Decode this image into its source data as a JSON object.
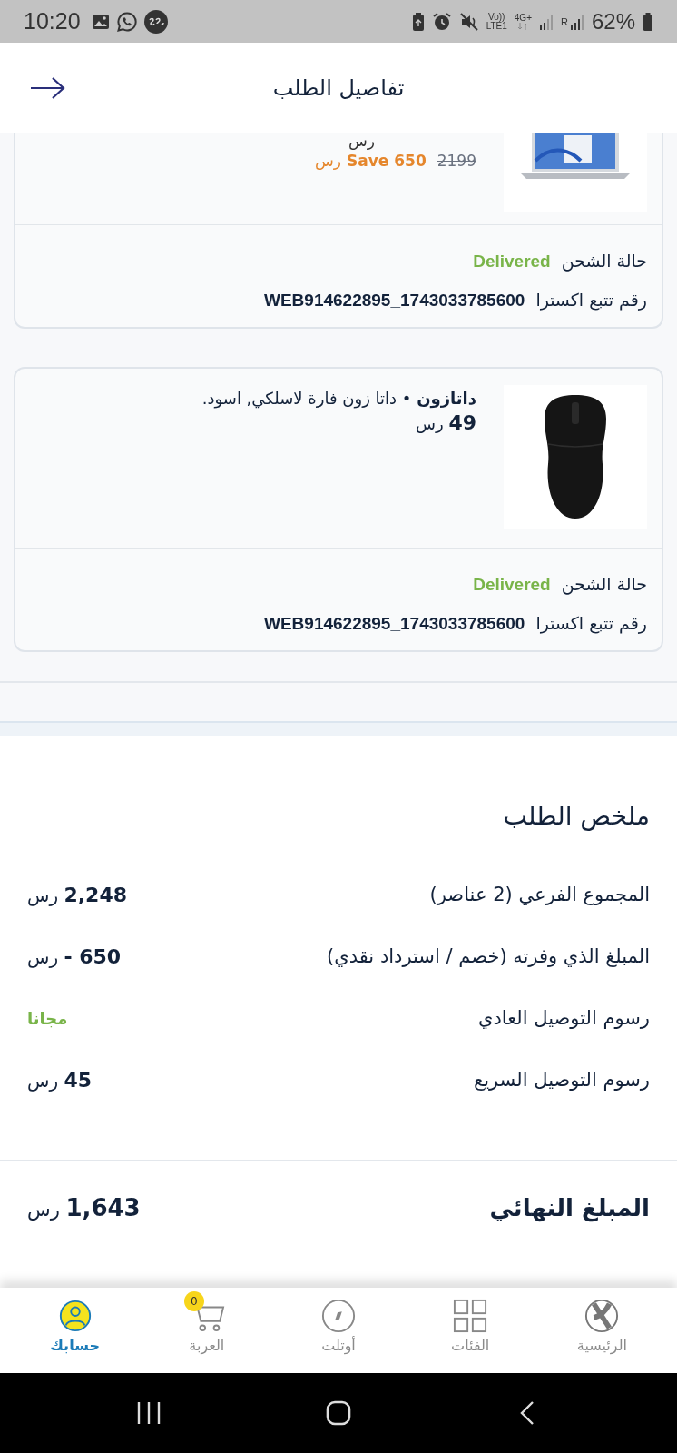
{
  "status_bar": {
    "time": "10:20",
    "volte_top": "Vo))",
    "volte_bottom": "LTE1",
    "network": "4G+",
    "roaming": "R",
    "battery": "62%"
  },
  "header": {
    "title": "تفاصيل الطلب"
  },
  "items": [
    {
      "kind": "laptop",
      "cut_currency": "رس",
      "original_price": "2199",
      "savings": "Save 650",
      "savings_currency": "رس",
      "shipping_label": "حالة الشحن",
      "shipping_status": "Delivered",
      "tracking_label": "رقم تتبع اكسترا",
      "tracking_number": "WEB914622895_1743033785600"
    },
    {
      "kind": "mouse",
      "brand": "داتازون",
      "separator": "•",
      "name": "داتا زون فارة لاسلكي, اسود.",
      "price": "49",
      "currency": "رس",
      "shipping_label": "حالة الشحن",
      "shipping_status": "Delivered",
      "tracking_label": "رقم تتبع اكسترا",
      "tracking_number": "WEB914622895_1743033785600"
    }
  ],
  "summary": {
    "title": "ملخص الطلب",
    "rows": [
      {
        "label": "المجموع الفرعي (2 عناصر)",
        "kind": "amount",
        "value": "2,248",
        "currency": "رس"
      },
      {
        "label": "المبلغ الذي وفرته (خصم / استرداد نقدي)",
        "kind": "amount",
        "value": "- 650",
        "currency": "رس"
      },
      {
        "label": "رسوم التوصيل العادي",
        "kind": "free",
        "value": "مجانا"
      },
      {
        "label": "رسوم التوصيل السريع",
        "kind": "amount",
        "value": "45",
        "currency": "رس"
      }
    ],
    "total": {
      "label": "المبلغ النهائي",
      "value": "1,643",
      "currency": "رس"
    }
  },
  "nav": [
    {
      "kind": "home",
      "label": "الرئيسية",
      "selected": false
    },
    {
      "kind": "categories",
      "label": "الفئات",
      "selected": false
    },
    {
      "kind": "outlet",
      "label": "أوتلت",
      "selected": false
    },
    {
      "kind": "cart",
      "label": "العربة",
      "selected": false,
      "badge": "0"
    },
    {
      "kind": "account",
      "label": "حسابك",
      "selected": true
    }
  ]
}
